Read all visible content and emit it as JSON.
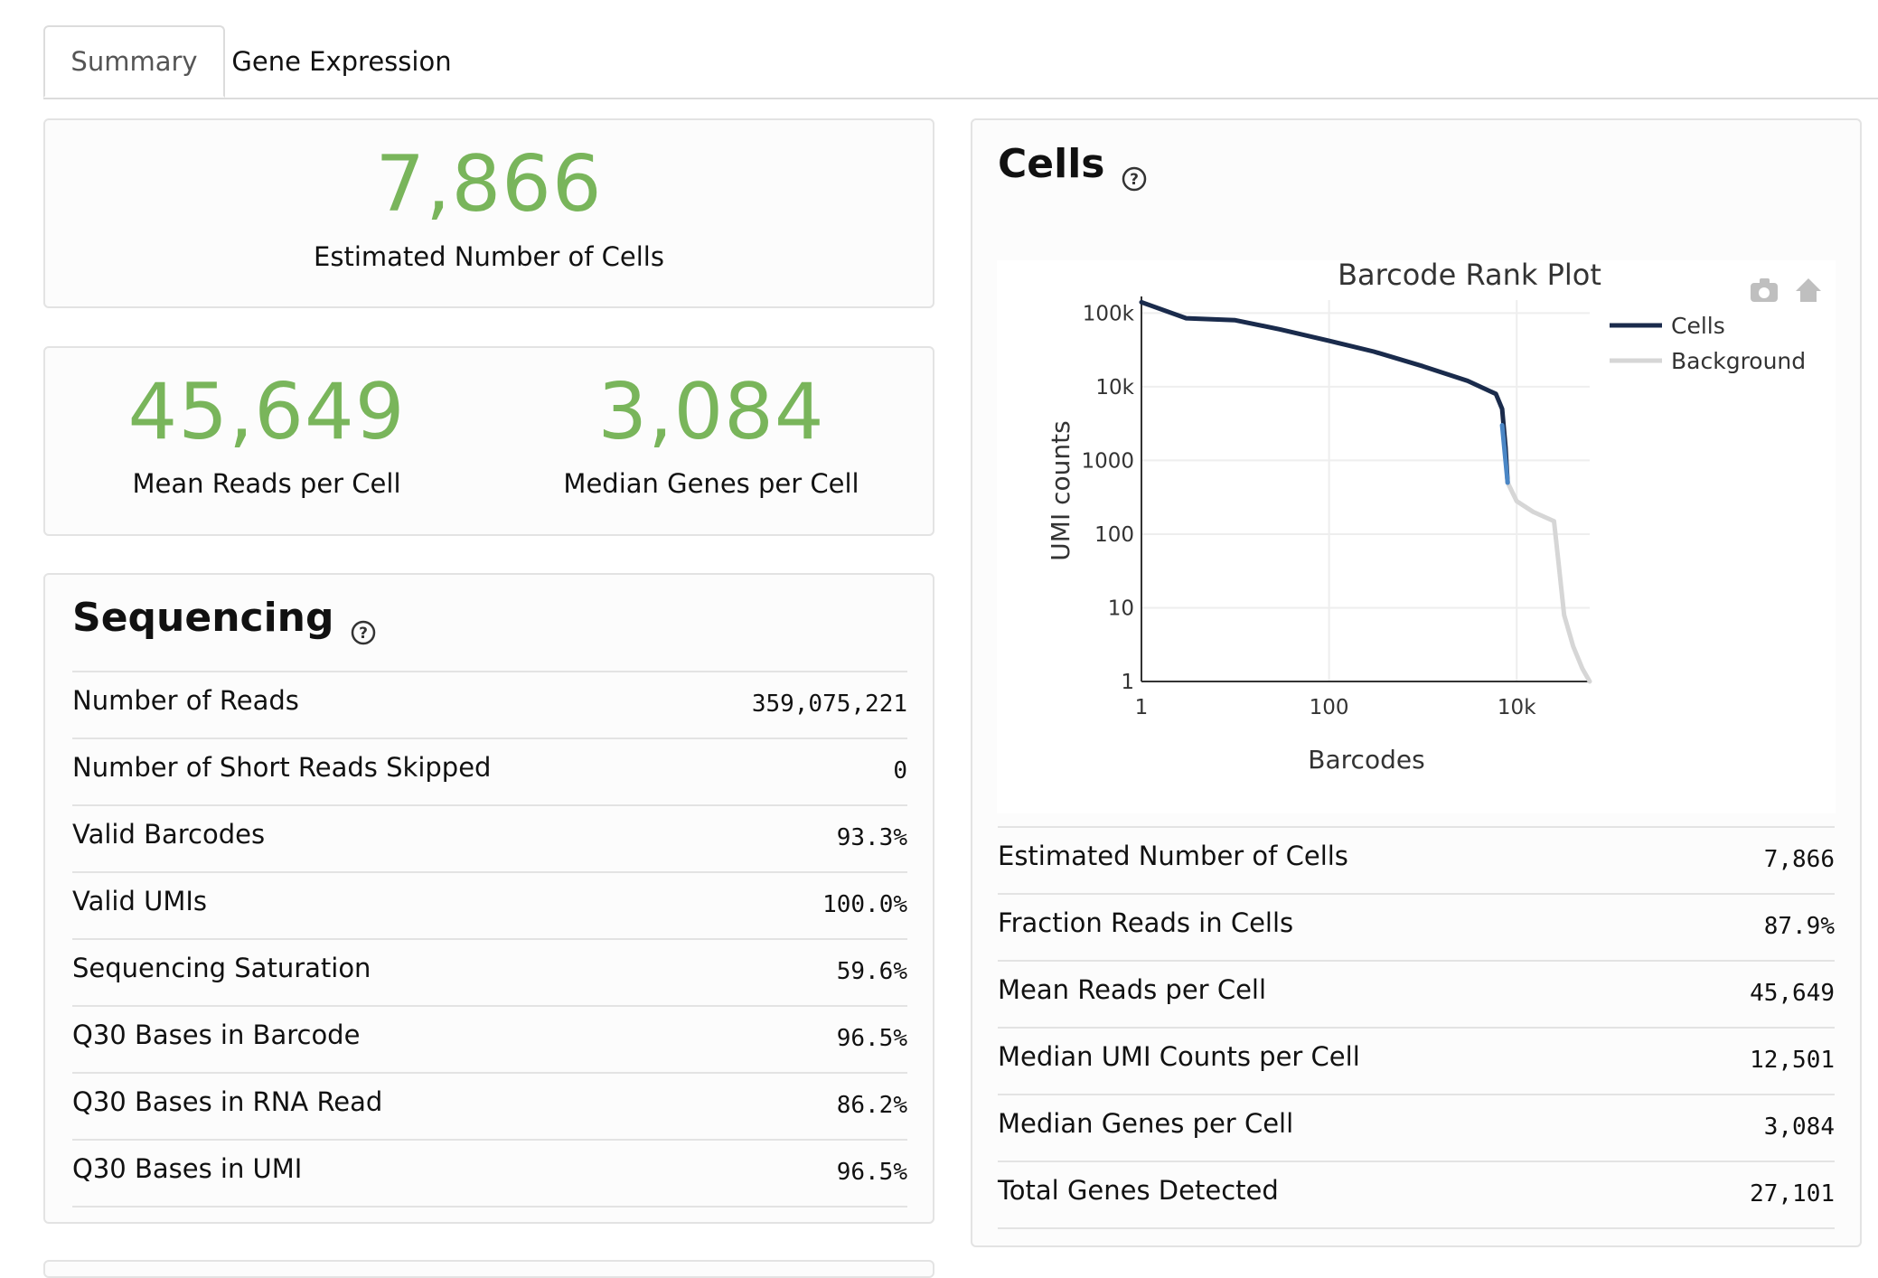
{
  "tabs": [
    {
      "label": "Summary",
      "active": true
    },
    {
      "label": "Gene Expression",
      "active": false
    }
  ],
  "hero": {
    "cells_value": "7,866",
    "cells_label": "Estimated Number of Cells",
    "reads_value": "45,649",
    "reads_label": "Mean Reads per Cell",
    "genes_value": "3,084",
    "genes_label": "Median Genes per Cell"
  },
  "sequencing": {
    "title": "Sequencing",
    "rows": [
      {
        "label": "Number of Reads",
        "value": "359,075,221"
      },
      {
        "label": "Number of Short Reads Skipped",
        "value": "0"
      },
      {
        "label": "Valid Barcodes",
        "value": "93.3%"
      },
      {
        "label": "Valid UMIs",
        "value": "100.0%"
      },
      {
        "label": "Sequencing Saturation",
        "value": "59.6%"
      },
      {
        "label": "Q30 Bases in Barcode",
        "value": "96.5%"
      },
      {
        "label": "Q30 Bases in RNA Read",
        "value": "86.2%"
      },
      {
        "label": "Q30 Bases in UMI",
        "value": "96.5%"
      }
    ]
  },
  "cells": {
    "title": "Cells",
    "rows": [
      {
        "label": "Estimated Number of Cells",
        "value": "7,866"
      },
      {
        "label": "Fraction Reads in Cells",
        "value": "87.9%"
      },
      {
        "label": "Mean Reads per Cell",
        "value": "45,649"
      },
      {
        "label": "Median UMI Counts per Cell",
        "value": "12,501"
      },
      {
        "label": "Median Genes per Cell",
        "value": "3,084"
      },
      {
        "label": "Total Genes Detected",
        "value": "27,101"
      }
    ]
  },
  "plot_toolbar": {
    "icons": [
      "camera-icon",
      "home-icon"
    ]
  },
  "chart_data": {
    "type": "line",
    "title": "Barcode Rank Plot",
    "xlabel": "Barcodes",
    "ylabel": "UMI counts",
    "x_scale": "log",
    "y_scale": "log",
    "xlim": [
      1,
      60000
    ],
    "ylim": [
      1,
      150000
    ],
    "x_ticks": [
      "1",
      "100",
      "10k"
    ],
    "y_ticks": [
      "1",
      "10",
      "100",
      "1000",
      "10k",
      "100k"
    ],
    "grid": true,
    "legend_position": "top-right",
    "series": [
      {
        "name": "Cells",
        "color": "#1a2b4c",
        "x": [
          1,
          3,
          10,
          30,
          100,
          300,
          1000,
          3000,
          6000,
          7000,
          7600,
          8000
        ],
        "y": [
          140000,
          85000,
          80000,
          60000,
          42000,
          30000,
          19000,
          12000,
          8000,
          5000,
          1500,
          500
        ]
      },
      {
        "name": "Background",
        "color": "#d6d6d6",
        "x": [
          8000,
          10000,
          15000,
          25000,
          28000,
          32000,
          40000,
          50000,
          60000
        ],
        "y": [
          500,
          280,
          200,
          150,
          40,
          8,
          3,
          1.5,
          1
        ]
      }
    ]
  }
}
